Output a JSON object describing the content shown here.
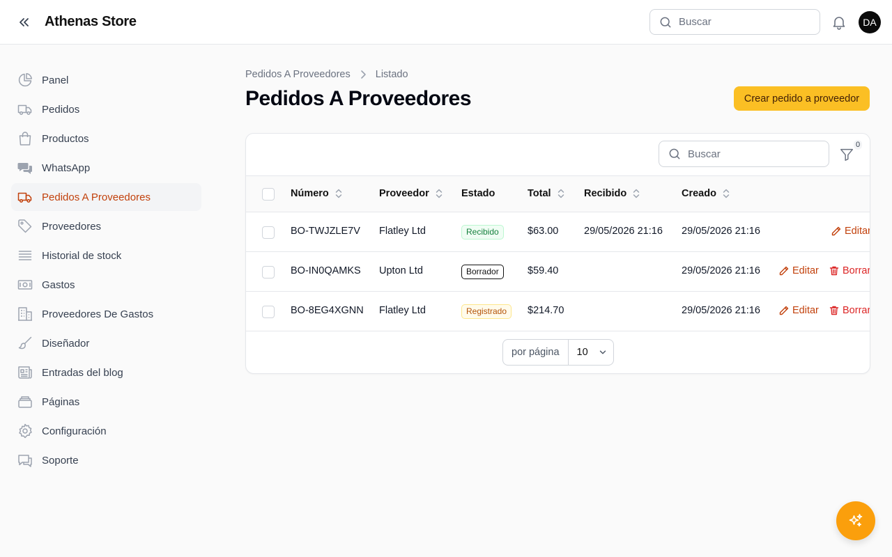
{
  "header": {
    "title": "Athenas Store",
    "search_placeholder": "Buscar",
    "avatar_initials": "DA"
  },
  "sidebar": {
    "items": [
      {
        "label": "Panel",
        "icon": "pie-chart-icon"
      },
      {
        "label": "Pedidos",
        "icon": "truck-icon"
      },
      {
        "label": "Productos",
        "icon": "shopping-bag-icon"
      },
      {
        "label": "WhatsApp",
        "icon": "chat-bubbles-icon"
      },
      {
        "label": "Pedidos A Proveedores",
        "icon": "truck-icon",
        "active": true
      },
      {
        "label": "Proveedores",
        "icon": "tag-icon"
      },
      {
        "label": "Historial de stock",
        "icon": "list-icon"
      },
      {
        "label": "Gastos",
        "icon": "banknote-icon"
      },
      {
        "label": "Proveedores De Gastos",
        "icon": "building-icon"
      },
      {
        "label": "Diseñador",
        "icon": "paintbrush-icon"
      },
      {
        "label": "Entradas del blog",
        "icon": "newspaper-icon"
      },
      {
        "label": "Páginas",
        "icon": "stack-icon"
      },
      {
        "label": "Configuración",
        "icon": "gear-icon"
      },
      {
        "label": "Soporte",
        "icon": "support-chat-icon"
      }
    ]
  },
  "breadcrumb": {
    "parent": "Pedidos A Proveedores",
    "current": "Listado"
  },
  "page": {
    "title": "Pedidos A Proveedores",
    "create_button": "Crear pedido a proveedor"
  },
  "table": {
    "search_placeholder": "Buscar",
    "filter_count": "0",
    "columns": {
      "numero": "Número",
      "proveedor": "Proveedor",
      "estado": "Estado",
      "total": "Total",
      "recibido": "Recibido",
      "creado": "Creado"
    },
    "rows": [
      {
        "numero": "BO-TWJZLE7V",
        "proveedor": "Flatley Ltd",
        "estado": "Recibido",
        "estado_color": "green",
        "total": "$63.00",
        "recibido": "29/05/2026 21:16",
        "creado": "29/05/2026 21:16",
        "edit": "Editar"
      },
      {
        "numero": "BO-IN0QAMKS",
        "proveedor": "Upton Ltd",
        "estado": "Borrador",
        "estado_color": "gray",
        "total": "$59.40",
        "recibido": "",
        "creado": "29/05/2026 21:16",
        "edit": "Editar",
        "delete": "Borrar"
      },
      {
        "numero": "BO-8EG4XGNN",
        "proveedor": "Flatley Ltd",
        "estado": "Registrado",
        "estado_color": "amber",
        "total": "$214.70",
        "recibido": "",
        "creado": "29/05/2026 21:16",
        "edit": "Editar",
        "delete": "Borrar"
      }
    ],
    "pagination": {
      "per_page_label": "por página",
      "per_page_value": "10"
    }
  },
  "colors": {
    "accent": "#c2410c",
    "primary_button": "#fbbf24",
    "fab": "#fb9f0c",
    "danger": "#dc2626",
    "success": "#15803d"
  }
}
